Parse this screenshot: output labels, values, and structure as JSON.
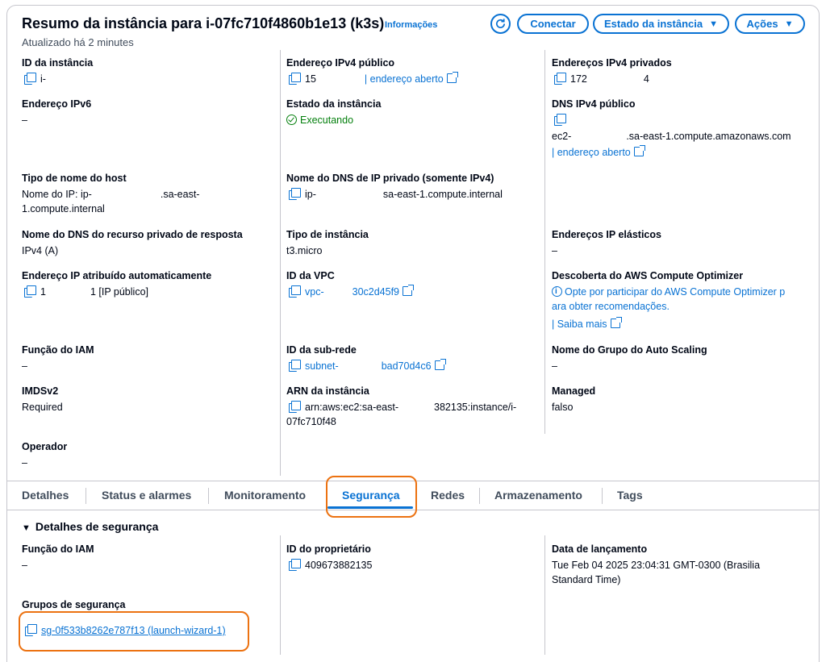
{
  "header": {
    "title": "Resumo da instância para i-07fc710f4860b1e13 (k3s)",
    "info": "Informações",
    "updated": "Atualizado há 2 minutes",
    "connect": "Conectar",
    "instance_state": "Estado da instância",
    "actions": "Ações"
  },
  "summary": {
    "instance_id": {
      "label": "ID da instância",
      "value": "i-"
    },
    "ipv4_public": {
      "label": "Endereço IPv4 público",
      "value": "15",
      "link": "| endereço aberto"
    },
    "ipv4_private": {
      "label": "Endereços IPv4 privados",
      "value": "172",
      "tail": "4"
    },
    "ipv6": {
      "label": "Endereço IPv6",
      "value": "–"
    },
    "state": {
      "label": "Estado da instância",
      "value": "Executando"
    },
    "dns_public": {
      "label": "DNS IPv4 público",
      "value_a": "ec2-",
      "value_b": ".sa-east-1.compute.amazonaws.com",
      "link": "| endereço aberto"
    },
    "hostname_type": {
      "label": "Tipo de nome do host",
      "value_a": "Nome do IP: ip-",
      "value_b": ".sa-east-",
      "value_c": "1.compute.internal"
    },
    "private_dns": {
      "label": "Nome do DNS de IP privado (somente IPv4)",
      "value_a": "ip-",
      "value_b": "sa-east-1.compute.internal"
    },
    "resource_dns": {
      "label": "Nome do DNS do recurso privado de resposta",
      "value": "IPv4 (A)"
    },
    "instance_type": {
      "label": "Tipo de instância",
      "value": "t3.micro"
    },
    "elastic_ip": {
      "label": "Endereços IP elásticos",
      "value": "–"
    },
    "auto_ip": {
      "label": "Endereço IP atribuído automaticamente",
      "value_a": "1",
      "value_b": "1 [IP público]"
    },
    "vpc_id": {
      "label": "ID da VPC",
      "value_a": "vpc-",
      "value_b": "30c2d45f9"
    },
    "optimizer": {
      "label": "Descoberta do AWS Compute Optimizer",
      "value_a": "Opte por participar do AWS Compute Optimizer p",
      "value_b": "ara obter recomendações.",
      "link": "| Saiba mais"
    },
    "iam_role": {
      "label": "Função do IAM",
      "value": "–"
    },
    "subnet_id": {
      "label": "ID da sub-rede",
      "value_a": "subnet-",
      "value_b": "bad70d4c6"
    },
    "asg_name": {
      "label": "Nome do Grupo do Auto Scaling",
      "value": "–"
    },
    "imdsv2": {
      "label": "IMDSv2",
      "value": "Required"
    },
    "arn": {
      "label": "ARN da instância",
      "value_a": "arn:aws:ec2:sa-east-",
      "value_b": "382135:instance/i-",
      "value_c": "07fc710f48"
    },
    "managed": {
      "label": "Managed",
      "value": "falso"
    },
    "operator": {
      "label": "Operador",
      "value": "–"
    }
  },
  "tabs": [
    "Detalhes",
    "Status e alarmes",
    "Monitoramento",
    "Segurança",
    "Redes",
    "Armazenamento",
    "Tags"
  ],
  "security": {
    "section_title": "Detalhes de segurança",
    "iam_role": {
      "label": "Função do IAM",
      "value": "–"
    },
    "owner_id": {
      "label": "ID do proprietário",
      "value": "409673882135"
    },
    "launch_date": {
      "label": "Data de lançamento",
      "value_a": "Tue Feb 04 2025 23:04:31 GMT-0300 (Brasilia",
      "value_b": "Standard Time)"
    },
    "security_groups": {
      "label": "Grupos de segurança",
      "value": "sg-0f533b8262e787f13 (launch-wizard-1)"
    }
  },
  "colors": {
    "accent": "#0972d3",
    "highlight": "#ec7211",
    "success": "#037f0c"
  }
}
